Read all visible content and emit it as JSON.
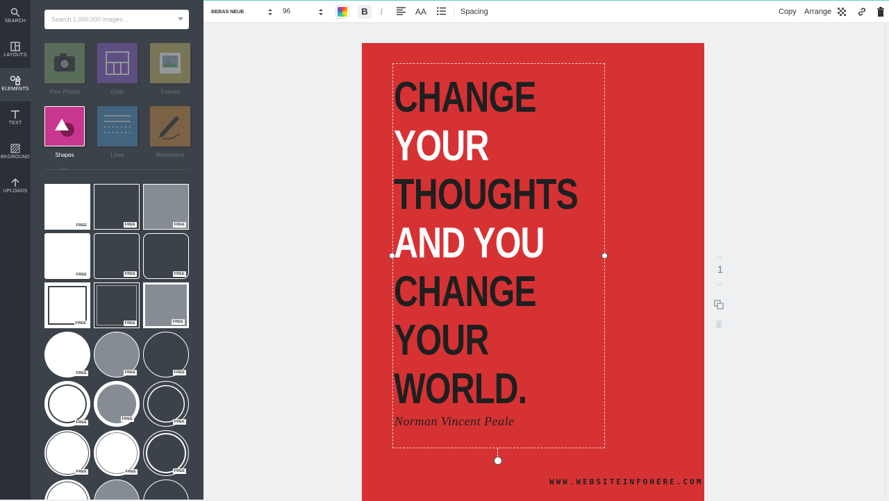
{
  "rail": {
    "items": [
      {
        "label": "SEARCH",
        "icon": "search-icon"
      },
      {
        "label": "LAYOUTS",
        "icon": "layouts-icon"
      },
      {
        "label": "ELEMENTS",
        "icon": "elements-icon"
      },
      {
        "label": "TEXT",
        "icon": "text-icon"
      },
      {
        "label": "BKGROUND",
        "icon": "background-icon"
      },
      {
        "label": "UPLOADS",
        "icon": "upload-icon"
      }
    ],
    "active": "ELEMENTS"
  },
  "panel": {
    "search_placeholder": "Search 1,000,000 images...",
    "categories": [
      {
        "label": "Free Photos"
      },
      {
        "label": "Grids"
      },
      {
        "label": "Frames"
      },
      {
        "label": "Shapes"
      },
      {
        "label": "Lines"
      },
      {
        "label": "Illustrations"
      }
    ],
    "active_category": "Shapes",
    "free_badge": "FREE"
  },
  "toolbar": {
    "font": "BEBAS NEUE",
    "font_size": "96",
    "bold": "B",
    "italic": "I",
    "case": "AA",
    "spacing": "Spacing",
    "copy": "Copy",
    "arrange": "Arrange"
  },
  "design": {
    "background_color": "#d63234",
    "quote_lines": [
      {
        "text": "CHANGE",
        "tone": "dark"
      },
      {
        "text": "YOUR",
        "tone": "light"
      },
      {
        "text": "THOUGHTS",
        "tone": "dark"
      },
      {
        "text": "AND YOU",
        "tone": "light"
      },
      {
        "text": "CHANGE",
        "tone": "dark"
      },
      {
        "text": "YOUR",
        "tone": "dark"
      },
      {
        "text": "WORLD.",
        "tone": "dark"
      }
    ],
    "author": "Norman Vincent Peale",
    "website": "WWW.WEBSITEINFOHERE.COM"
  },
  "page_number": "1"
}
